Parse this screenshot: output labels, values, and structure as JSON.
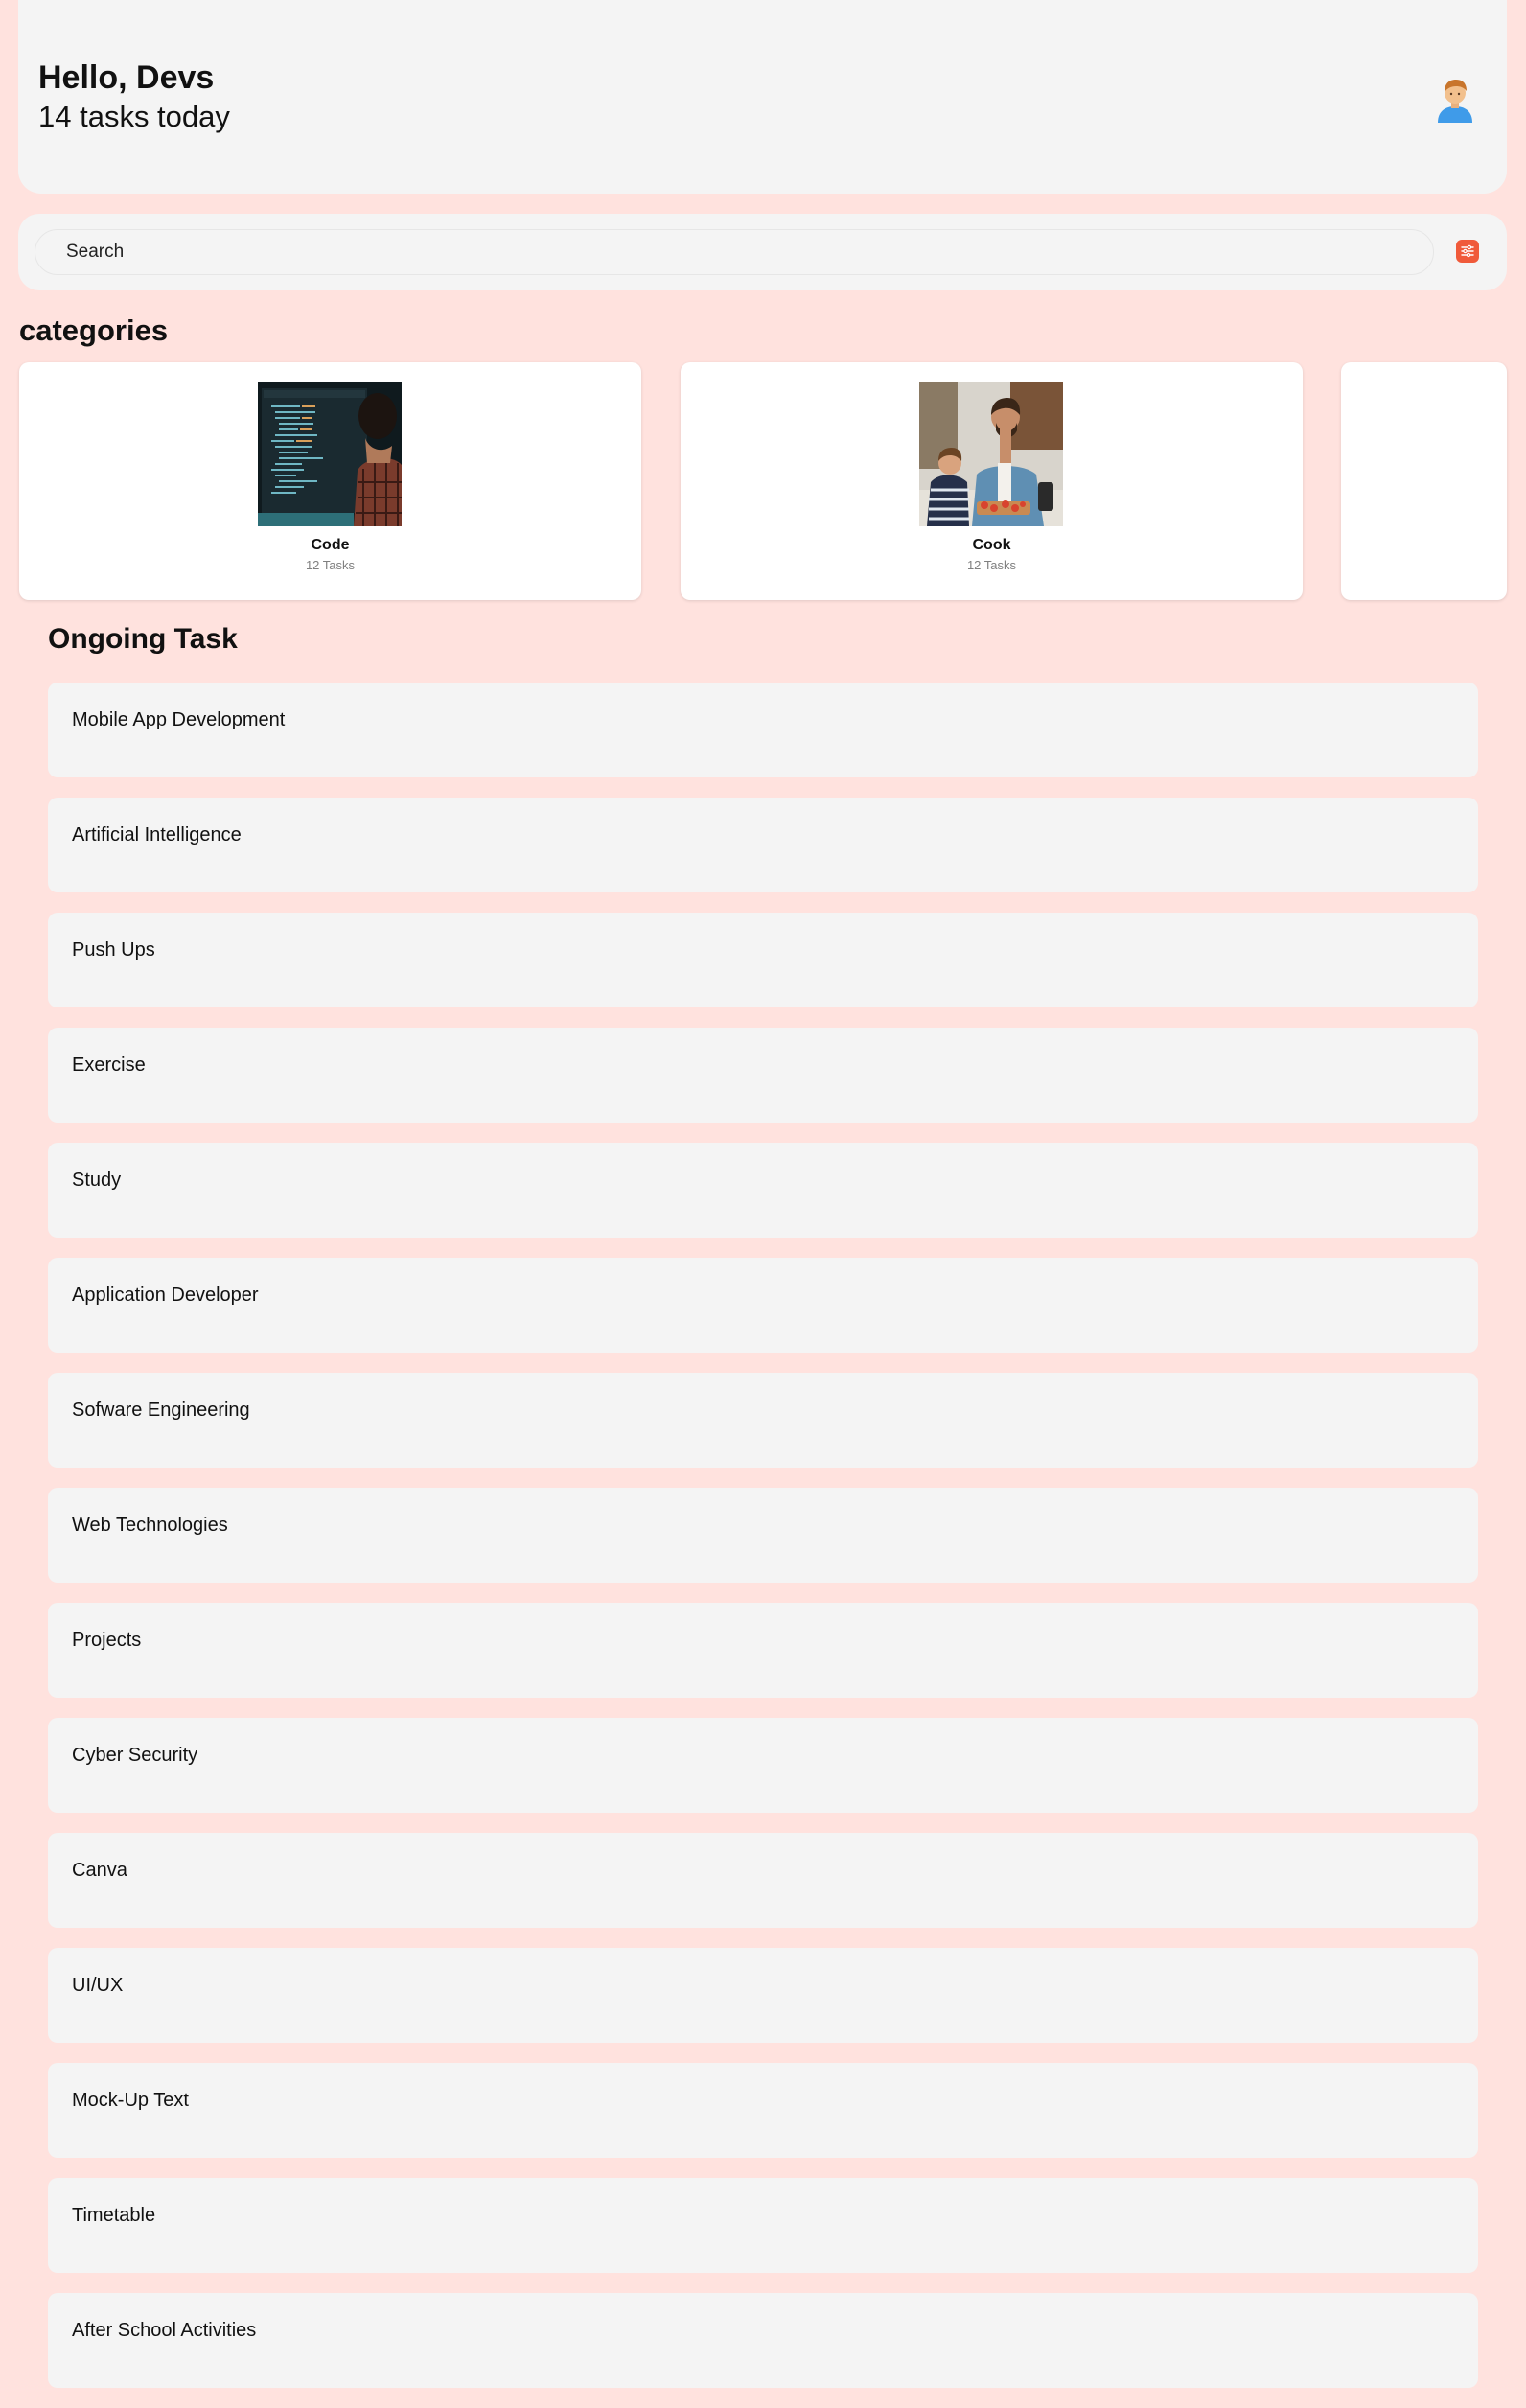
{
  "header": {
    "greeting": "Hello, Devs",
    "subtitle": "14 tasks today",
    "avatar_icon": "person-avatar-icon"
  },
  "search": {
    "placeholder": "Search",
    "value": "",
    "filter_icon": "sliders-icon",
    "filter_color": "#f05a3a"
  },
  "categories": {
    "title": "categories",
    "items": [
      {
        "name": "Code",
        "count": "12 Tasks",
        "image": "person-coding-photo"
      },
      {
        "name": "Cook",
        "count": "12 Tasks",
        "image": "father-son-cooking-photo"
      },
      {
        "name": "",
        "count": "",
        "image": ""
      }
    ]
  },
  "ongoing": {
    "title": "Ongoing Task",
    "tasks": [
      "Mobile App Development",
      "Artificial Intelligence",
      "Push Ups",
      "Exercise",
      "Study",
      "Application Developer",
      "Sofware Engineering",
      "Web Technologies",
      "Projects",
      "Cyber Security",
      "Canva",
      "UI/UX",
      "Mock-Up Text",
      "Timetable",
      "After School Activities"
    ]
  },
  "colors": {
    "background": "#ffe2de",
    "panel": "#f4f4f4",
    "card": "#ffffff",
    "accent": "#f05a3a"
  }
}
